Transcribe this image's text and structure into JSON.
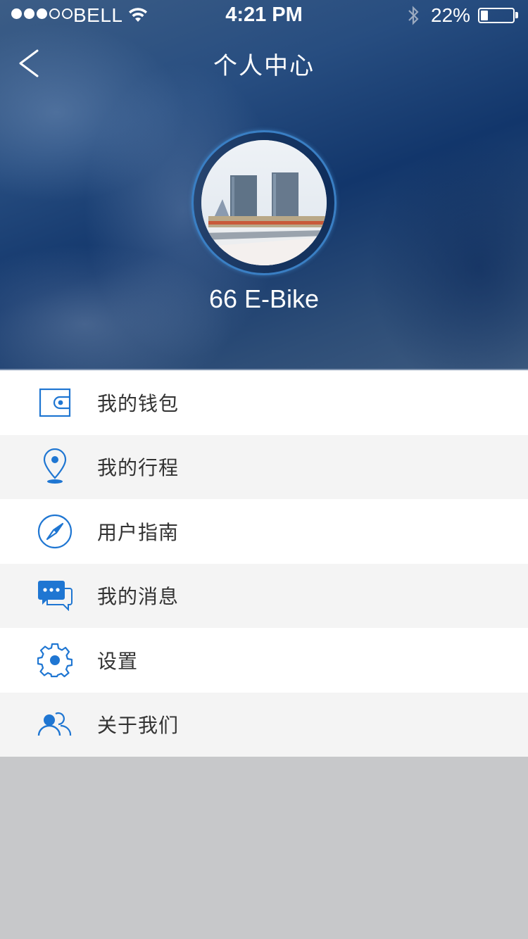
{
  "status_bar": {
    "carrier": "BELL",
    "time": "4:21 PM",
    "battery": "22%",
    "battery_level": 0.22
  },
  "nav": {
    "title": "个人中心",
    "back_icon": "chevron-left-icon"
  },
  "profile": {
    "username": "66 E-Bike"
  },
  "menu": {
    "items": [
      {
        "label": "我的钱包",
        "icon": "wallet-icon"
      },
      {
        "label": "我的行程",
        "icon": "location-pin-icon"
      },
      {
        "label": "用户指南",
        "icon": "compass-icon"
      },
      {
        "label": "我的消息",
        "icon": "chat-bubble-icon"
      },
      {
        "label": "设置",
        "icon": "gear-icon"
      },
      {
        "label": "关于我们",
        "icon": "users-icon"
      }
    ]
  },
  "colors": {
    "accent": "#1f76d2",
    "header_dark": "#12366b",
    "row_alt": "#f4f4f4",
    "background": "#c7c8ca"
  }
}
